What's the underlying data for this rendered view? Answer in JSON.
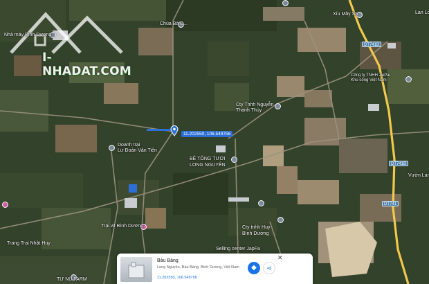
{
  "map": {
    "place_labels": [
      {
        "id": "nha-may-binh-duong",
        "text": "Nhà máy Bình Dương"
      },
      {
        "id": "chua-ba-d",
        "text": "Chùa Bà Đ..."
      },
      {
        "id": "xiu-may",
        "text": "Xíu Mây Sa"
      },
      {
        "id": "lan-lo",
        "text": "Lan Lo"
      },
      {
        "id": "cong-ty-jiepai",
        "text": "Công ty TNHH JiePai\nKhu công Việt Nam"
      },
      {
        "id": "cty-nguyen-than-thuy",
        "text": "Cty Tnhh Nguyễn\nThanh Thủy"
      },
      {
        "id": "van-tien",
        "text": "Doanh trại\nLư Đoàn Văn Tiến"
      },
      {
        "id": "be-tong",
        "text": "BÊ TÔNG TƯƠI\nLONG NGUYÊN"
      },
      {
        "id": "vuon-lan",
        "text": "Vườn Lan"
      },
      {
        "id": "trai-vit",
        "text": "Trại vịt Bình Dương"
      },
      {
        "id": "cty-huy",
        "text": "Cty tnhh Huy\nBình Dương"
      },
      {
        "id": "trang-trai-nhat-huy",
        "text": "Trang Trại Nhật Huy"
      },
      {
        "id": "selling-center",
        "text": "Selling center JapFa"
      },
      {
        "id": "tu-nu-farm",
        "text": "TƯ NU FARM"
      }
    ],
    "road_shields": [
      "DT741B",
      "DT741B",
      "DT741"
    ],
    "selected_coordinates_label": "11.202550, 106.549756"
  },
  "watermark": {
    "text": "I-NHADAT.COM"
  },
  "place_card": {
    "name": "Bàu Bàng",
    "address": "Long Nguyên, Bàu Bàng, Bình Dương, Việt Nam",
    "coordinates": "11.202550, 106.549756",
    "close_icon": "close-icon",
    "directions_icon": "directions-icon",
    "share_icon": "share-icon"
  },
  "colors": {
    "accent": "#1a73e8",
    "highway": "#f2c94c",
    "pin_pink": "#d55aa8"
  }
}
